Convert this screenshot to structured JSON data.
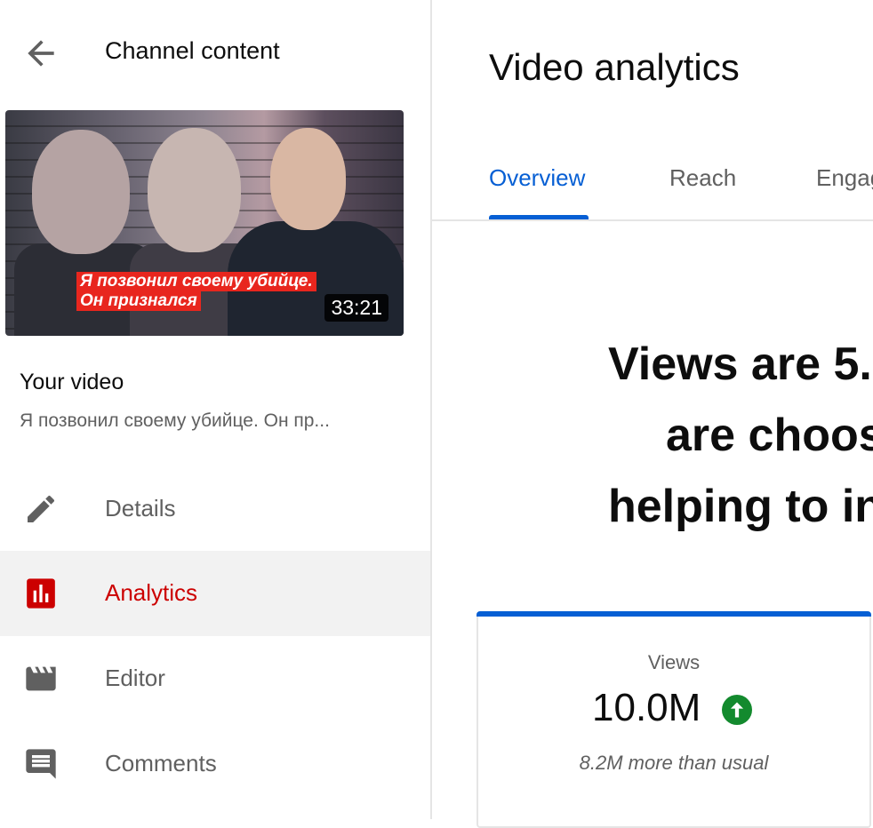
{
  "sidebar": {
    "title": "Channel content",
    "video": {
      "duration": "33:21",
      "caption_line1": "Я позвонил своему убийце.",
      "caption_line2": "Он признался",
      "section_label": "Your video",
      "title": "Я позвонил своему убийце. Он пр..."
    },
    "nav": [
      {
        "label": "Details",
        "icon": "pencil-icon",
        "active": false
      },
      {
        "label": "Analytics",
        "icon": "analytics-icon",
        "active": true
      },
      {
        "label": "Editor",
        "icon": "clapperboard-icon",
        "active": false
      },
      {
        "label": "Comments",
        "icon": "comment-icon",
        "active": false
      }
    ]
  },
  "main": {
    "title": "Video analytics",
    "tabs": [
      {
        "label": "Overview",
        "active": true
      },
      {
        "label": "Reach",
        "active": false
      },
      {
        "label": "Engag",
        "active": false
      }
    ],
    "headline": {
      "line1": "Views are 5.",
      "line2": "are choos",
      "line3": "helping to in"
    },
    "metric": {
      "label": "Views",
      "value": "10.0M",
      "trend_icon": "arrow-up-icon",
      "comparison": "8.2M more than usual"
    }
  },
  "colors": {
    "accent_blue": "#065fd4",
    "active_red": "#cc0000",
    "trend_green": "#138a2e",
    "caption_red": "#e8261e"
  }
}
